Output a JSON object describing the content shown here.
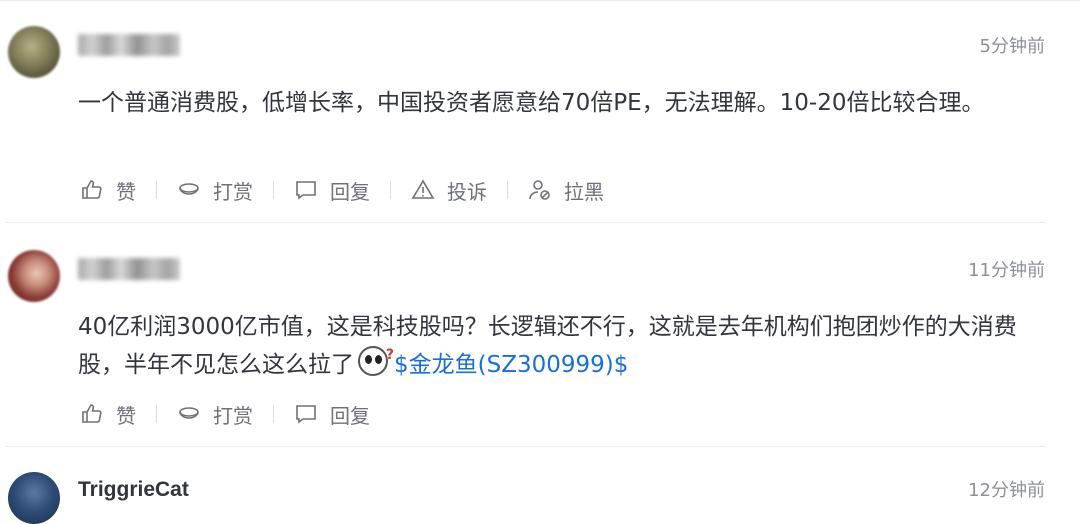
{
  "comments": [
    {
      "time": "5分钟前",
      "text": "一个普通消费股，低增长率，中国投资者愿意给70倍PE，无法理解。10-20倍比较合理。",
      "actions": [
        "赞",
        "打赏",
        "回复",
        "投诉",
        "拉黑"
      ]
    },
    {
      "time": "11分钟前",
      "text": "40亿利润3000亿市值，这是科技股吗？长逻辑还不行，这就是去年机构们抱团炒作的大消费股，半年不见怎么这么拉了",
      "emoji": "?",
      "stock_link": "$金龙鱼(SZ300999)$",
      "actions": [
        "赞",
        "打赏",
        "回复"
      ]
    },
    {
      "username": "TriggrieCat",
      "time": "12分钟前"
    }
  ],
  "icons": {
    "like": "thumbs-up-icon",
    "reward": "coin-icon",
    "reply": "comment-icon",
    "report": "warning-icon",
    "block": "user-block-icon"
  },
  "colors": {
    "link": "#1a6ed8",
    "text": "#33353c",
    "muted": "#8e9097"
  }
}
